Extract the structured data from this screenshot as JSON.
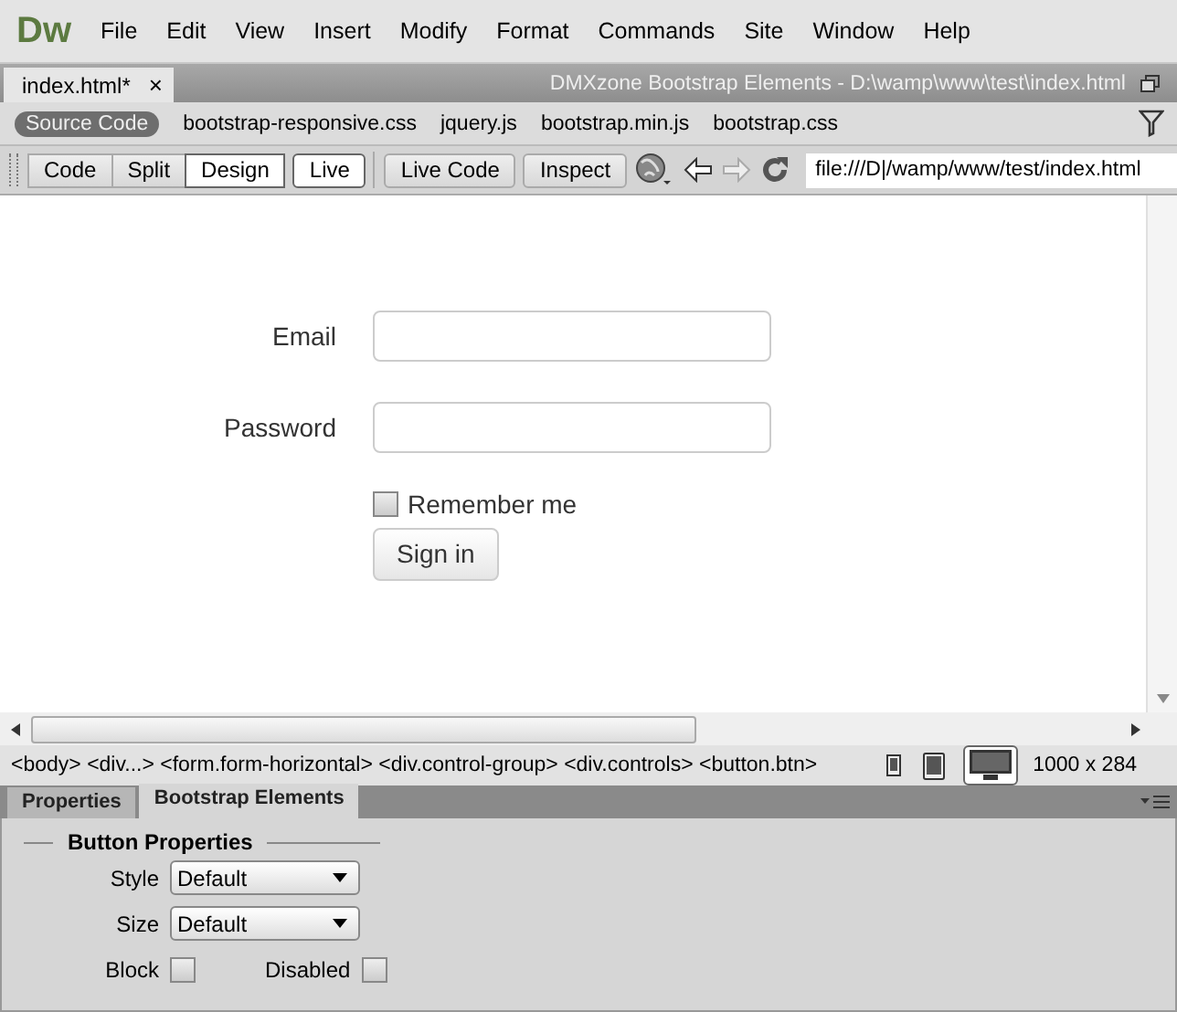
{
  "app": {
    "logo": "Dw",
    "menu": [
      "File",
      "Edit",
      "View",
      "Insert",
      "Modify",
      "Format",
      "Commands",
      "Site",
      "Window",
      "Help"
    ]
  },
  "document_tab": {
    "label": "index.html*",
    "close": "×",
    "path": "DMXzone Bootstrap Elements - D:\\wamp\\www\\test\\index.html"
  },
  "related_files": [
    {
      "label": "Source Code",
      "selected": true
    },
    {
      "label": "bootstrap-responsive.css",
      "selected": false
    },
    {
      "label": "jquery.js",
      "selected": false
    },
    {
      "label": "bootstrap.min.js",
      "selected": false
    },
    {
      "label": "bootstrap.css",
      "selected": false
    }
  ],
  "toolbar": {
    "views": [
      {
        "label": "Code",
        "selected": false
      },
      {
        "label": "Split",
        "selected": false
      },
      {
        "label": "Design",
        "selected": true
      }
    ],
    "buttons": [
      "Live",
      "Live Code",
      "Inspect"
    ],
    "address": "file:///D|/wamp/www/test/index.html"
  },
  "form": {
    "fields": [
      {
        "label": "Email"
      },
      {
        "label": "Password"
      }
    ],
    "remember": {
      "label": "Remember me",
      "checked": false
    },
    "submit": "Sign in"
  },
  "status_bar": {
    "tags": "<body> <div...> <form.form-horizontal> <div.control-group> <div.controls> <button.btn>",
    "devices": [
      {
        "kind": "phone",
        "selected": false
      },
      {
        "kind": "tablet",
        "selected": false
      },
      {
        "kind": "desktop",
        "selected": true
      }
    ],
    "size": "1000 x 284"
  },
  "panel": {
    "tabs": [
      {
        "label": "Properties",
        "selected": false
      },
      {
        "label": "Bootstrap Elements",
        "selected": true
      }
    ],
    "section": "Button Properties",
    "selects": [
      {
        "label": "Style",
        "value": "Default"
      },
      {
        "label": "Size",
        "value": "Default"
      }
    ],
    "checks": [
      {
        "label": "Block",
        "checked": false
      },
      {
        "label": "Disabled",
        "checked": false
      }
    ]
  }
}
